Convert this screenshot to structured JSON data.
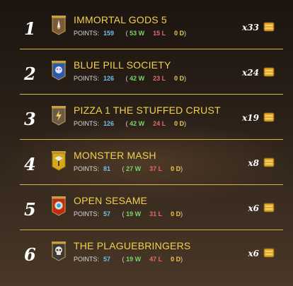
{
  "guilds": [
    {
      "rank": "1",
      "name": "IMMORTAL GODS 5",
      "points_label": "POINTS:",
      "points": "159",
      "wins": "53 W",
      "losses": "15 L",
      "draws": "0 D",
      "multiplier": "x33",
      "emblem_icon": "dagger-banner-icon",
      "banner_color": "#7a5a3a"
    },
    {
      "rank": "2",
      "name": "BLUE PILL SOCIETY",
      "points_label": "POINTS:",
      "points": "126",
      "wins": "42 W",
      "losses": "23 L",
      "draws": "0 D",
      "multiplier": "x24",
      "emblem_icon": "mask-banner-icon",
      "banner_color": "#2a5aa8"
    },
    {
      "rank": "3",
      "name": "PIZZA 1 THE STUFFED CRUST",
      "points_label": "POINTS:",
      "points": "126",
      "wins": "42 W",
      "losses": "24 L",
      "draws": "0 D",
      "multiplier": "x19",
      "emblem_icon": "lightning-banner-icon",
      "banner_color": "#6a5a4a"
    },
    {
      "rank": "4",
      "name": "MONSTER MASH",
      "points_label": "POINTS:",
      "points": "81",
      "wins": "27 W",
      "losses": "37 L",
      "draws": "0 D",
      "multiplier": "x8",
      "emblem_icon": "axe-banner-icon",
      "banner_color": "#d6a81c"
    },
    {
      "rank": "5",
      "name": "OPEN SESAME",
      "points_label": "POINTS:",
      "points": "57",
      "wins": "19 W",
      "losses": "31 L",
      "draws": "0 D",
      "multiplier": "x6",
      "emblem_icon": "orb-banner-icon",
      "banner_color": "#c0281c"
    },
    {
      "rank": "6",
      "name": "THE PLAGUEBRINGERS",
      "points_label": "POINTS:",
      "points": "57",
      "wins": "19 W",
      "losses": "47 L",
      "draws": "0 D",
      "multiplier": "x6",
      "emblem_icon": "skull-banner-icon",
      "banner_color": "#3a3a3a"
    }
  ],
  "reward_icon": "reward-chest-icon",
  "colors": {
    "accent_gold": "#f3d04f",
    "points_blue": "#6fc1e8",
    "wins_green": "#7cd36b",
    "losses_red": "#e46a6a",
    "divider": "#d9b44a"
  }
}
